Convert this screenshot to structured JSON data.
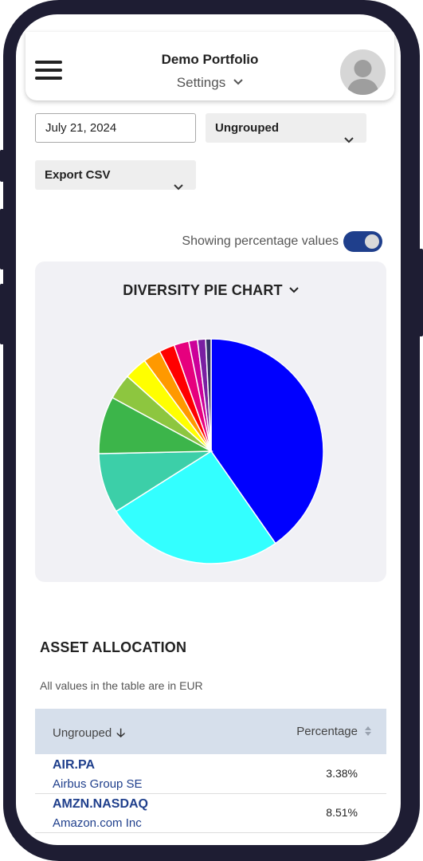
{
  "header": {
    "portfolio_name": "Demo Portfolio",
    "settings_label": "Settings"
  },
  "controls": {
    "date_value": "July 21, 2024",
    "group_select": "Ungrouped",
    "export_select": "Export CSV",
    "toggle_label": "Showing percentage values",
    "toggle_on": true
  },
  "chart_card": {
    "title": "DIVERSITY PIE CHART"
  },
  "chart_data": {
    "type": "pie",
    "title": "DIVERSITY PIE CHART",
    "values": [
      41.5,
      26.5,
      8.9,
      8.5,
      3.8,
      3.4,
      2.6,
      2.3,
      2.2,
      1.3,
      1.2,
      0.8
    ],
    "colors": [
      "#0000ff",
      "#33ffff",
      "#3ccfa8",
      "#3cb54a",
      "#8dc63f",
      "#ffff00",
      "#ff9900",
      "#ff0000",
      "#e6007e",
      "#cc0099",
      "#7a1fa2",
      "#333366"
    ]
  },
  "allocation": {
    "title": "ASSET ALLOCATION",
    "subtitle": "All values in the table are in EUR",
    "col_group": "Ungrouped",
    "col_percentage": "Percentage",
    "rows": [
      {
        "symbol": "AIR.PA",
        "name": "Airbus Group SE",
        "pct": "3.38%"
      },
      {
        "symbol": "AMZN.NASDAQ",
        "name": "Amazon.com Inc",
        "pct": "8.51%"
      }
    ]
  }
}
